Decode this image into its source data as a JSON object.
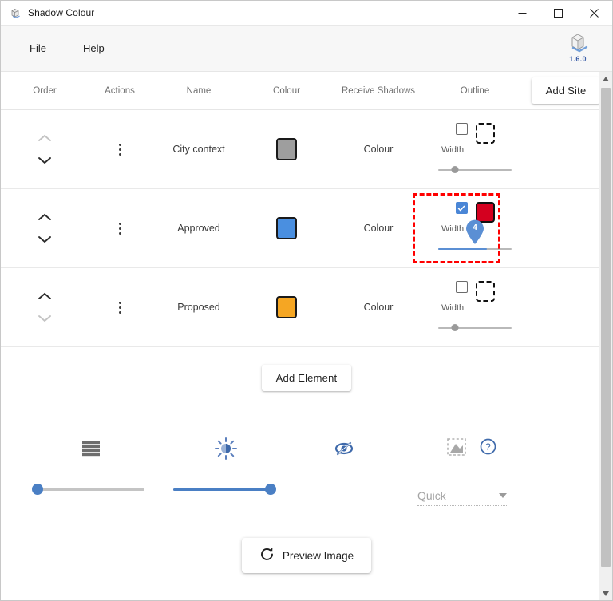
{
  "window": {
    "title": "Shadow Colour",
    "icon": "app-cube-icon",
    "controls": {
      "minimize": "─",
      "maximize": "□",
      "close": "✕"
    }
  },
  "menubar": {
    "items": [
      {
        "label": "File",
        "name": "menu-file"
      },
      {
        "label": "Help",
        "name": "menu-help"
      }
    ],
    "brand": {
      "icon": "cube-logo-icon",
      "version": "1.6.0",
      "version_color": "#3b5ea8"
    }
  },
  "table": {
    "headers": {
      "order": "Order",
      "actions": "Actions",
      "name": "Name",
      "colour": "Colour",
      "receive_shadows": "Receive Shadows",
      "outline": "Outline"
    },
    "add_site_label": "Add Site",
    "rows": [
      {
        "name": "City context",
        "colour_label": "Colour",
        "swatch_color": "#9e9e9e",
        "up_enabled": false,
        "down_enabled": true,
        "outline": {
          "checked": false,
          "width_label": "Width",
          "outline_swatch": "none",
          "outline_swatch_color": "",
          "slider_value": 25,
          "slider_active": false,
          "pin_value": null
        },
        "highlighted": false
      },
      {
        "name": "Approved",
        "colour_label": "Colour",
        "swatch_color": "#4a8fe0",
        "up_enabled": true,
        "down_enabled": true,
        "outline": {
          "checked": true,
          "width_label": "Width",
          "outline_swatch": "solid",
          "outline_swatch_color": "#d4001f",
          "slider_value": 65,
          "slider_active": true,
          "pin_value": "4"
        },
        "highlighted": true
      },
      {
        "name": "Proposed",
        "colour_label": "Colour",
        "swatch_color": "#f5a623",
        "up_enabled": true,
        "down_enabled": false,
        "outline": {
          "checked": false,
          "width_label": "Width",
          "outline_swatch": "none",
          "outline_swatch_color": "",
          "slider_value": 25,
          "slider_active": false,
          "pin_value": null
        },
        "highlighted": false
      }
    ]
  },
  "add_element": {
    "label": "Add Element"
  },
  "tools": {
    "items": [
      {
        "icon": "layers-lines-icon",
        "slider_value": 0,
        "slider_active": false
      },
      {
        "icon": "brightness-sun-icon",
        "slider_value": 100,
        "slider_active": true
      },
      {
        "icon": "eye-off-icon",
        "slider_value": null,
        "slider_active": false
      }
    ],
    "export": {
      "image_icon": "image-crop-icon",
      "help_icon": "help-circle-icon",
      "quality_value": "Quick",
      "dropdown_icon": "caret-down-icon"
    }
  },
  "preview": {
    "label": "Preview Image",
    "icon": "refresh-icon"
  },
  "colors": {
    "accent_blue": "#4a7fc4",
    "highlight_red": "#ff0000",
    "text_dark": "#1f1f1f",
    "text_muted": "#707070"
  }
}
